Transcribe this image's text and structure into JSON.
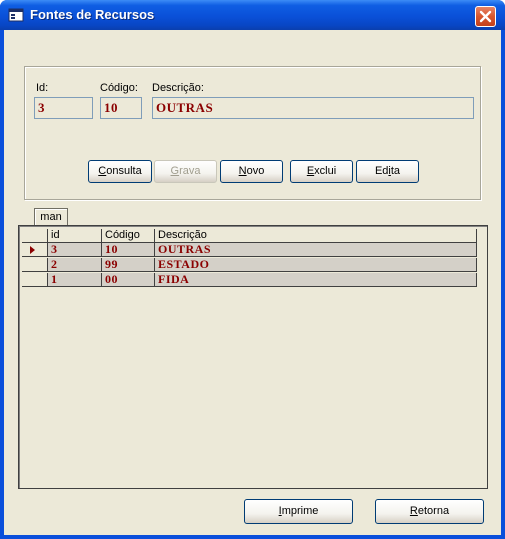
{
  "window": {
    "title": "Fontes de Recursos",
    "app_icon": "form-icon",
    "close_icon": "close-icon"
  },
  "form": {
    "id_label": "Id:",
    "id_value": "3",
    "codigo_label": "Código:",
    "codigo_value": "10",
    "descricao_label": "Descrição:",
    "descricao_value": "OUTRAS"
  },
  "buttons": {
    "consulta": {
      "prefix": "",
      "underline": "C",
      "rest": "onsulta"
    },
    "grava": {
      "prefix": "",
      "underline": "G",
      "rest": "rava",
      "disabled": true
    },
    "novo": {
      "prefix": "",
      "underline": "N",
      "rest": "ovo"
    },
    "exclui": {
      "prefix": "",
      "underline": "E",
      "rest": "xclui"
    },
    "edita": {
      "prefix": "Ed",
      "underline": "i",
      "rest": "ta"
    }
  },
  "tab_label": "man",
  "grid": {
    "columns": [
      "id",
      "Código",
      "Descrição"
    ],
    "rows": [
      {
        "id": "3",
        "codigo": "10",
        "descricao": "OUTRAS",
        "current": true
      },
      {
        "id": "2",
        "codigo": "99",
        "descricao": "ESTADO",
        "current": false
      },
      {
        "id": "1",
        "codigo": "00",
        "descricao": "FIDA",
        "current": false
      }
    ]
  },
  "footer": {
    "imprime": {
      "prefix": "",
      "underline": "I",
      "rest": "mprime"
    },
    "retorna": {
      "prefix": "",
      "underline": "R",
      "rest": "etorna"
    }
  },
  "colors": {
    "title_bar": "#0a50d8",
    "window_bg": "#ece9d8",
    "data_text": "#8b0000",
    "close_button": "#d7562e"
  }
}
